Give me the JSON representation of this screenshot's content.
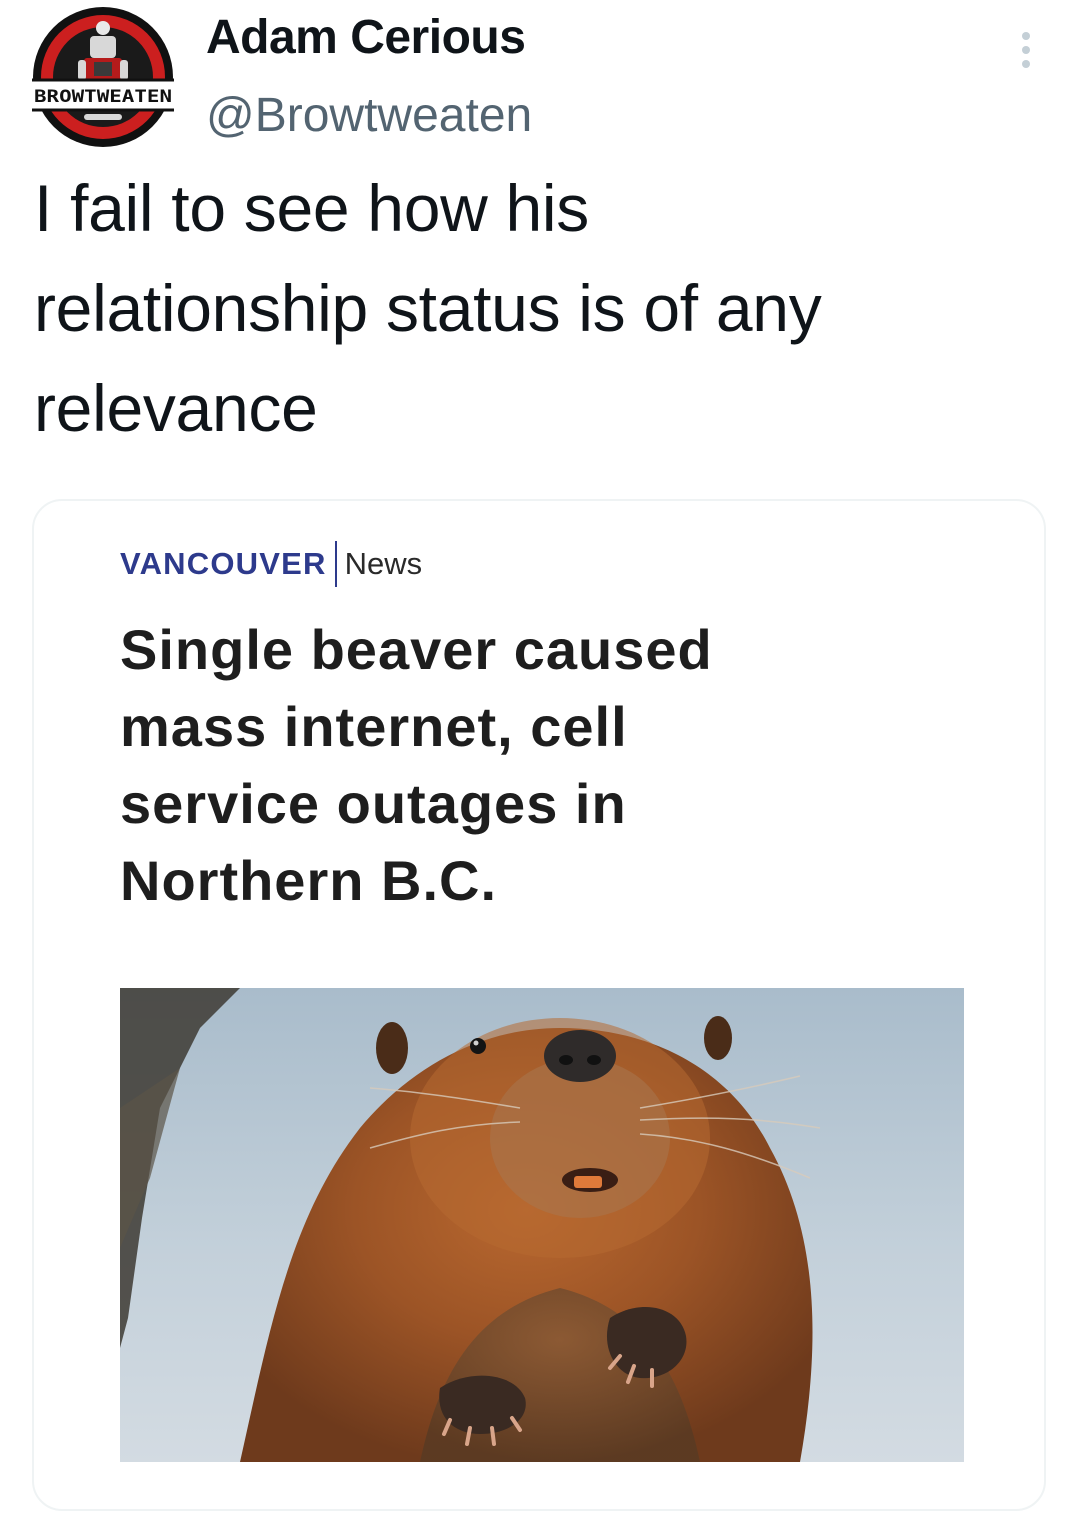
{
  "author": {
    "display_name": "Adam Cerious",
    "handle": "@Browtweaten",
    "avatar_badge_text": "BROWTWEATEN",
    "avatar_icon": "browtweaten-logo"
  },
  "tweet": {
    "text_lines": [
      "I fail to see how his",
      "relationship status is of any",
      "relevance"
    ]
  },
  "more_icon": "more-vertical-icon",
  "card": {
    "source_brand": "VANCOUVER",
    "source_section": "News",
    "headline_lines": [
      "Single beaver caused",
      "mass internet, cell",
      "service outages in",
      "Northern B.C."
    ],
    "image_subject": "beaver"
  },
  "colors": {
    "text": "#0f1419",
    "secondary_text": "#536471",
    "card_border": "#eff3f4",
    "source_brand": "#2d3a8c",
    "avatar_ring": "#111111",
    "avatar_red": "#cc1f1f"
  }
}
